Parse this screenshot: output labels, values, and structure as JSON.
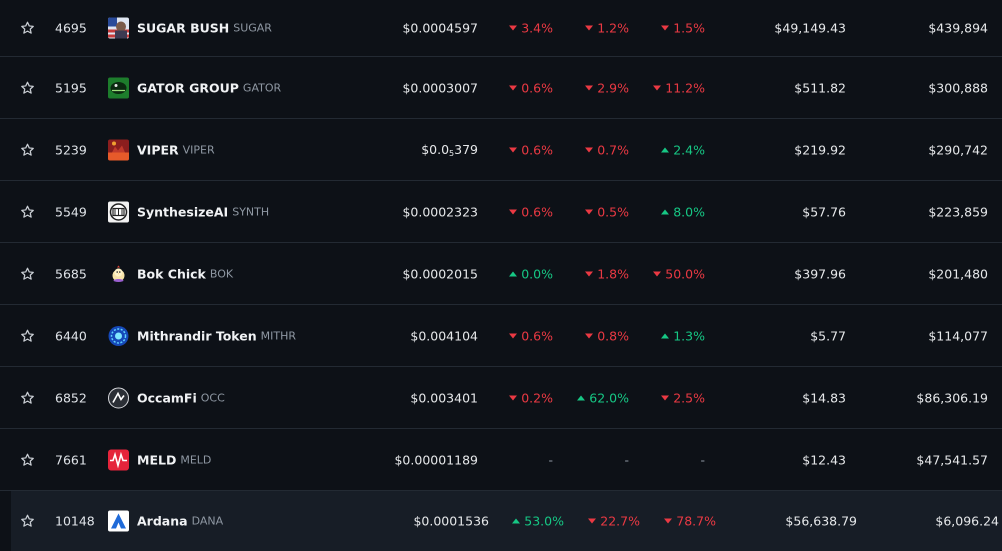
{
  "rows": [
    {
      "rank": "4695",
      "name": "SUGAR BUSH",
      "symbol": "SUGAR",
      "logo": "sugar-bush-logo",
      "price": "$0.0004597",
      "price_sub": "",
      "price_tail": "",
      "change_1h": "3.4%",
      "change_1h_dir": "down",
      "change_24h": "1.2%",
      "change_24h_dir": "down",
      "change_7d": "1.5%",
      "change_7d_dir": "down",
      "volume": "$49,149.43",
      "market_cap": "$439,894"
    },
    {
      "rank": "5195",
      "name": "GATOR GROUP",
      "symbol": "GATOR",
      "logo": "gator-group-logo",
      "price": "$0.0003007",
      "price_sub": "",
      "price_tail": "",
      "change_1h": "0.6%",
      "change_1h_dir": "down",
      "change_24h": "2.9%",
      "change_24h_dir": "down",
      "change_7d": "11.2%",
      "change_7d_dir": "down",
      "volume": "$511.82",
      "market_cap": "$300,888"
    },
    {
      "rank": "5239",
      "name": "VIPER",
      "symbol": "VIPER",
      "logo": "viper-logo",
      "price": "$0.0",
      "price_sub": "5",
      "price_tail": "379",
      "change_1h": "0.6%",
      "change_1h_dir": "down",
      "change_24h": "0.7%",
      "change_24h_dir": "down",
      "change_7d": "2.4%",
      "change_7d_dir": "up",
      "volume": "$219.92",
      "market_cap": "$290,742"
    },
    {
      "rank": "5549",
      "name": "SynthesizeAI",
      "symbol": "SYNTH",
      "logo": "synthesizeai-logo",
      "price": "$0.0002323",
      "price_sub": "",
      "price_tail": "",
      "change_1h": "0.6%",
      "change_1h_dir": "down",
      "change_24h": "0.5%",
      "change_24h_dir": "down",
      "change_7d": "8.0%",
      "change_7d_dir": "up",
      "volume": "$57.76",
      "market_cap": "$223,859"
    },
    {
      "rank": "5685",
      "name": "Bok Chick",
      "symbol": "BOK",
      "logo": "bok-chick-logo",
      "price": "$0.0002015",
      "price_sub": "",
      "price_tail": "",
      "change_1h": "0.0%",
      "change_1h_dir": "up",
      "change_24h": "1.8%",
      "change_24h_dir": "down",
      "change_7d": "50.0%",
      "change_7d_dir": "down",
      "volume": "$397.96",
      "market_cap": "$201,480"
    },
    {
      "rank": "6440",
      "name": "Mithrandir Token",
      "symbol": "MITHR",
      "logo": "mithrandir-logo",
      "price": "$0.004104",
      "price_sub": "",
      "price_tail": "",
      "change_1h": "0.6%",
      "change_1h_dir": "down",
      "change_24h": "0.8%",
      "change_24h_dir": "down",
      "change_7d": "1.3%",
      "change_7d_dir": "up",
      "volume": "$5.77",
      "market_cap": "$114,077"
    },
    {
      "rank": "6852",
      "name": "OccamFi",
      "symbol": "OCC",
      "logo": "occamfi-logo",
      "price": "$0.003401",
      "price_sub": "",
      "price_tail": "",
      "change_1h": "0.2%",
      "change_1h_dir": "down",
      "change_24h": "62.0%",
      "change_24h_dir": "up",
      "change_7d": "2.5%",
      "change_7d_dir": "down",
      "volume": "$14.83",
      "market_cap": "$86,306.19"
    },
    {
      "rank": "7661",
      "name": "MELD",
      "symbol": "MELD",
      "logo": "meld-logo",
      "price": "$0.00001189",
      "price_sub": "",
      "price_tail": "",
      "change_1h": "-",
      "change_1h_dir": "none",
      "change_24h": "-",
      "change_24h_dir": "none",
      "change_7d": "-",
      "change_7d_dir": "none",
      "volume": "$12.43",
      "market_cap": "$47,541.57"
    },
    {
      "rank": "10148",
      "name": "Ardana",
      "symbol": "DANA",
      "logo": "ardana-logo",
      "price": "$0.0001536",
      "price_sub": "",
      "price_tail": "",
      "change_1h": "53.0%",
      "change_1h_dir": "up",
      "change_24h": "22.7%",
      "change_24h_dir": "down",
      "change_7d": "78.7%",
      "change_7d_dir": "down",
      "volume": "$56,638.79",
      "market_cap": "$6,096.24"
    }
  ],
  "colors": {
    "background": "#0d1117",
    "row_hover": "#171d26",
    "divider": "#232a33",
    "down": "#ea3943",
    "up": "#16c784",
    "muted": "#8f98a3"
  },
  "icons": {
    "star": "star-outline-icon",
    "down": "caret-down-icon",
    "up": "caret-up-icon"
  }
}
